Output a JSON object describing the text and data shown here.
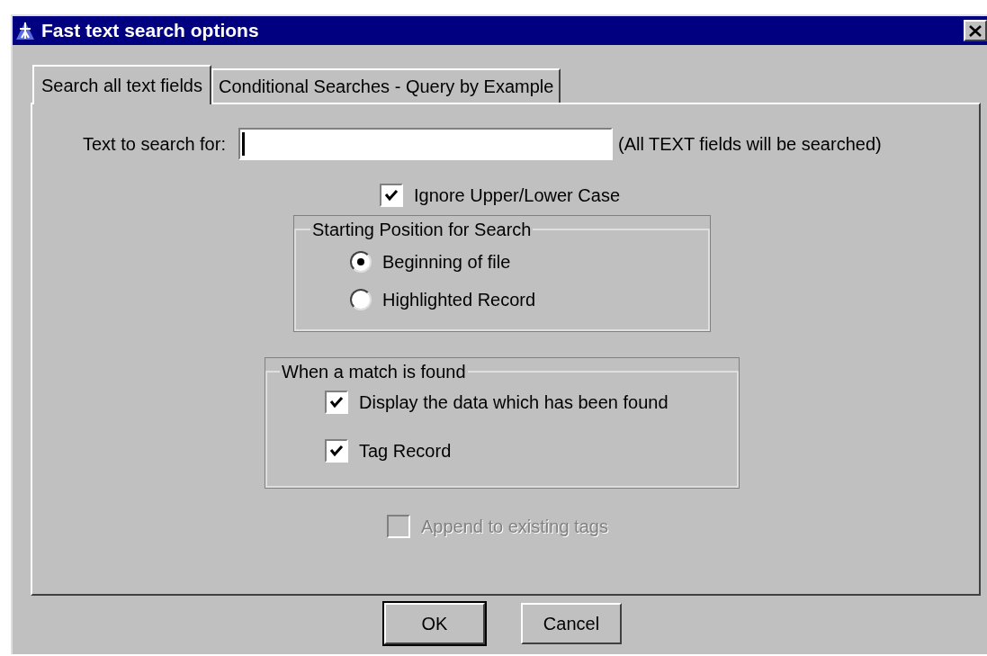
{
  "window": {
    "title": "Fast text search options"
  },
  "tabs": [
    {
      "label": "Search all text fields",
      "selected": true
    },
    {
      "label": "Conditional Searches - Query by Example",
      "selected": false
    }
  ],
  "search": {
    "label": "Text to search for:",
    "focused": true,
    "hint": "(All TEXT fields will be searched)"
  },
  "ignore_case": {
    "label": "Ignore Upper/Lower Case",
    "checked": true
  },
  "starting_position": {
    "title": "Starting Position for Search",
    "options": [
      {
        "label": "Beginning of file",
        "selected": true
      },
      {
        "label": "Highlighted Record",
        "selected": false
      }
    ]
  },
  "when_found": {
    "title": "When a match is found",
    "options": [
      {
        "label": "Display the data which has been found",
        "checked": true
      },
      {
        "label": "Tag Record",
        "checked": true
      }
    ]
  },
  "append_tags": {
    "label": "Append to existing tags",
    "checked": false,
    "disabled": true
  },
  "buttons": [
    {
      "label": "OK",
      "default": true
    },
    {
      "label": "Cancel",
      "default": false
    }
  ]
}
